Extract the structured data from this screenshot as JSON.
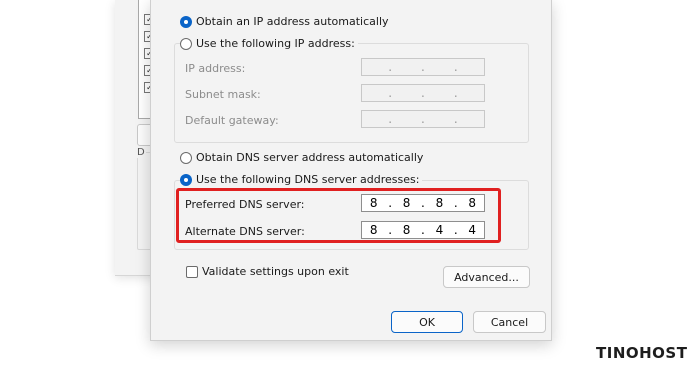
{
  "ip_section": {
    "auto_label": "Obtain an IP address automatically",
    "manual_label": "Use the following IP address:",
    "selected": "auto",
    "fields": [
      {
        "label": "IP address:",
        "value": [
          ".",
          ".",
          "."
        ]
      },
      {
        "label": "Subnet mask:",
        "value": [
          ".",
          ".",
          "."
        ]
      },
      {
        "label": "Default gateway:",
        "value": [
          ".",
          ".",
          "."
        ]
      }
    ]
  },
  "dns_section": {
    "auto_label": "Obtain DNS server address automatically",
    "manual_label": "Use the following DNS server addresses:",
    "selected": "manual",
    "preferred": {
      "label": "Preferred DNS server:",
      "octets": [
        "8",
        "8",
        "8",
        "8"
      ]
    },
    "alternate": {
      "label": "Alternate DNS server:",
      "octets": [
        "8",
        "8",
        "4",
        "4"
      ]
    }
  },
  "validate_label": "Validate settings upon exit",
  "validate_checked": false,
  "advanced_button": "Advanced...",
  "ok_button": "OK",
  "cancel_button": "Cancel",
  "background_window": {
    "group_label": "D",
    "checkmarks": [
      "✓",
      "✓",
      "✓",
      "✓",
      "✓"
    ]
  },
  "watermark": "TINOHOST",
  "colors": {
    "accent": "#0a64c8",
    "highlight": "#e02020"
  }
}
